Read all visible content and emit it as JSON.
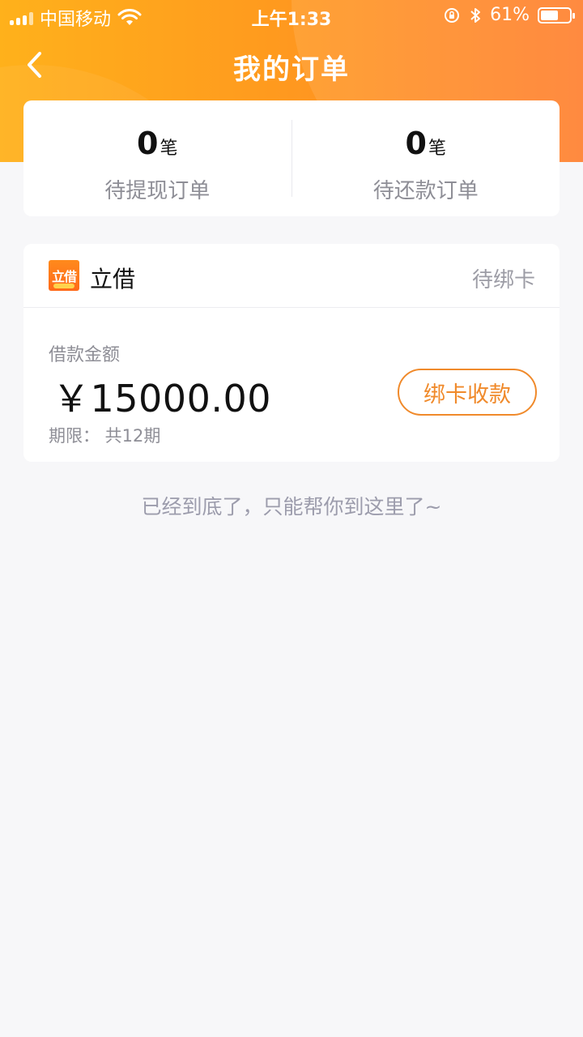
{
  "status_bar": {
    "carrier": "中国移动",
    "time": "上午1:33",
    "battery_percent": "61%",
    "battery_level": 0.61
  },
  "nav": {
    "title": "我的订单"
  },
  "summary": {
    "withdraw": {
      "count": "0",
      "unit": "笔",
      "label": "待提现订单"
    },
    "repay": {
      "count": "0",
      "unit": "笔",
      "label": "待还款订单"
    }
  },
  "order": {
    "brand_logo_text": "立借",
    "brand_name": "立借",
    "status": "待绑卡",
    "amount_label": "借款金额",
    "amount": "￥15000.00",
    "term": "期限：  共12期",
    "action_label": "绑卡收款"
  },
  "footer": {
    "end_text": "已经到底了，只能帮你到这里了~"
  },
  "colors": {
    "header_start": "#ffb11b",
    "header_end": "#ff7d2b",
    "accent": "#f08a2b",
    "muted_text": "#8e8e96",
    "page_bg": "#f7f7f9"
  }
}
